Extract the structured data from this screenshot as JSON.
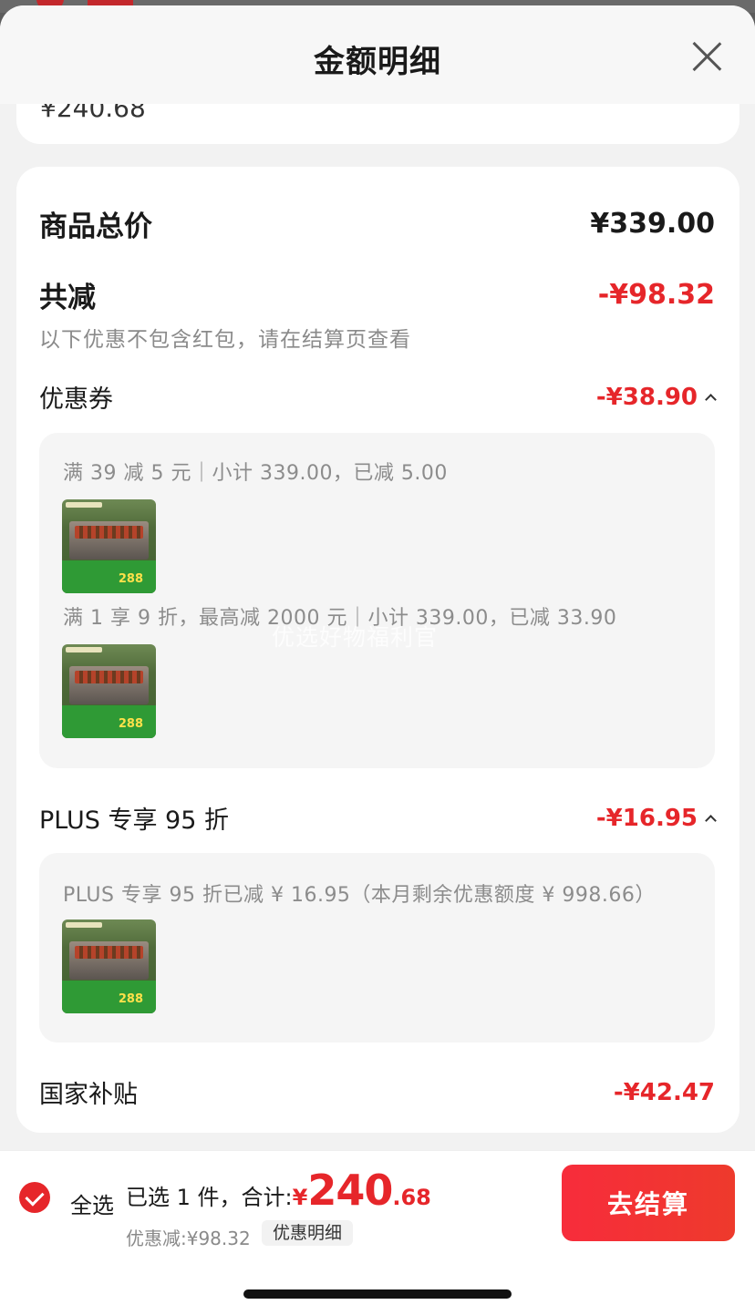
{
  "sheet": {
    "title": "金额明细",
    "previous_card_text": "¥240.68"
  },
  "summary": {
    "goods_total_label": "商品总价",
    "goods_total_value": "¥339.00",
    "total_reduce_label": "共减",
    "total_reduce_value": "-¥98.32",
    "note": "以下优惠不包含红包，请在结算页查看"
  },
  "coupon": {
    "label": "优惠券",
    "value": "-¥38.90",
    "details": [
      {
        "text": "满 39 减 5 元｜小计 339.00，已减 5.00"
      },
      {
        "text": "满 1 享 9 折，最高减 2000 元｜小计 339.00，已减 33.90"
      }
    ]
  },
  "plus": {
    "label": "PLUS 专享 95 折",
    "value": "-¥16.95",
    "detail": "PLUS 专享 95 折已减 ¥ 16.95（本月剩余优惠额度 ¥ 998.66）"
  },
  "subsidy": {
    "label": "国家补贴",
    "value": "-¥42.47"
  },
  "product_thumb": {
    "price_text": "288"
  },
  "watermark": "优选好物福利官",
  "bottom": {
    "select_all": "全选",
    "selected_text": "已选 1 件，合计:",
    "currency": "¥",
    "total_int": "240",
    "total_dec": ".68",
    "discount": "优惠减:¥98.32",
    "detail_link": "优惠明细",
    "checkout": "去结算"
  },
  "colors": {
    "accent_red": "#e6262a",
    "sheet_bg": "#f2f2f2"
  }
}
